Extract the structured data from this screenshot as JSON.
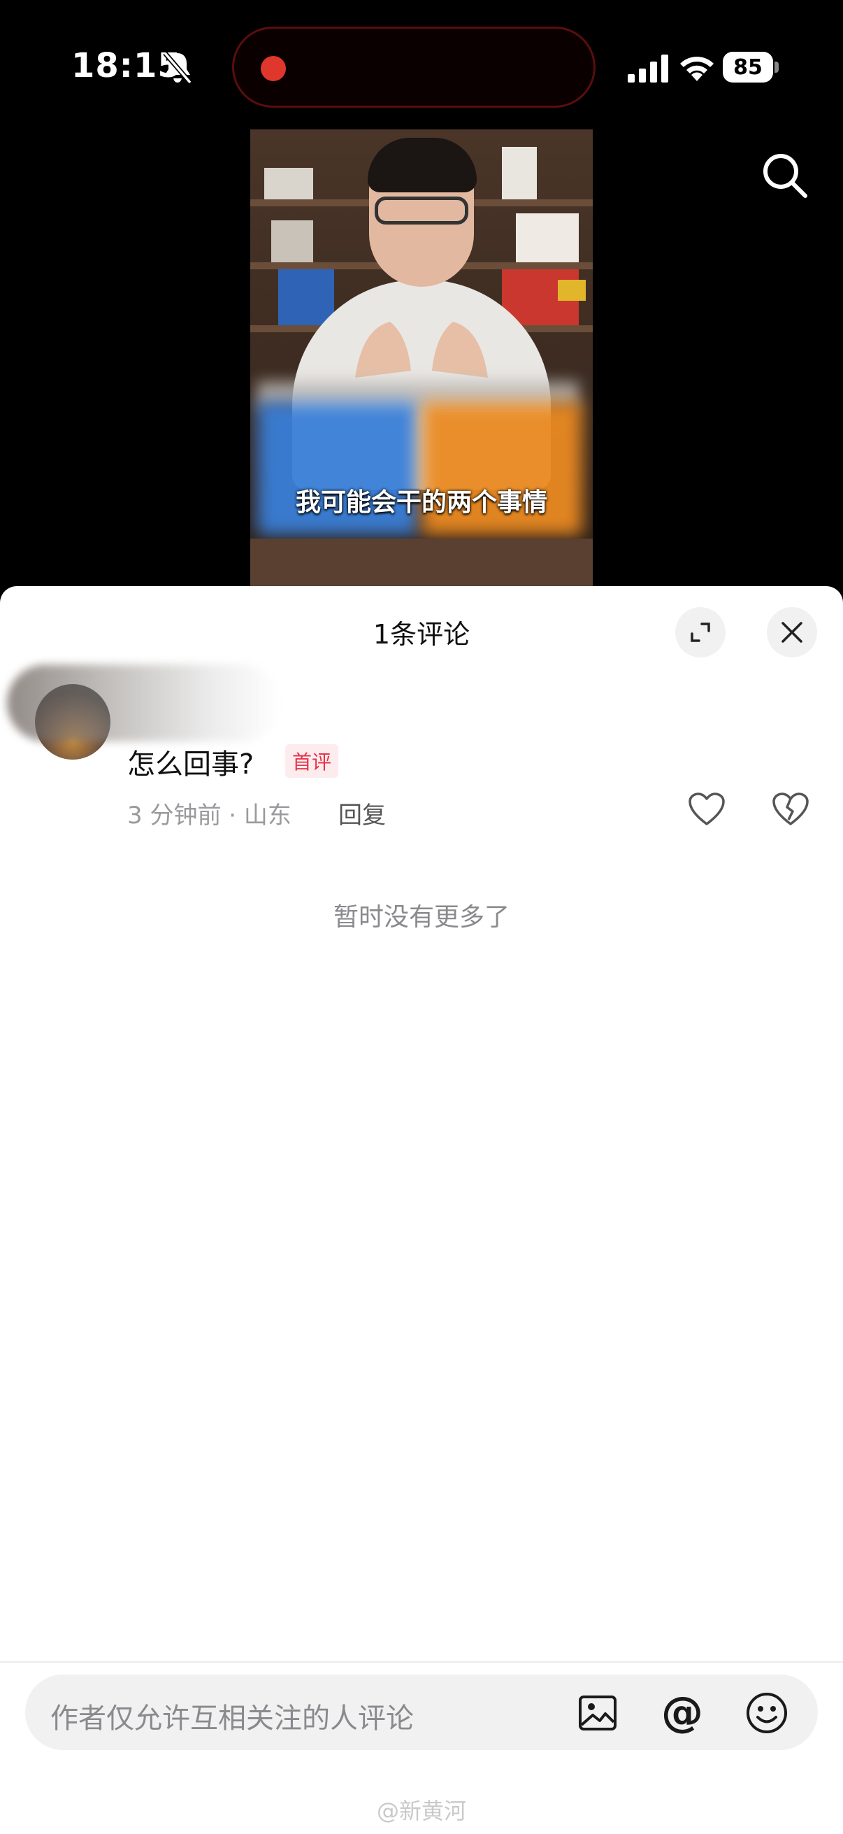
{
  "status_bar": {
    "time": "18:15",
    "battery": "85",
    "icons": [
      "bell-slash-icon",
      "recording-dot",
      "signal-icon",
      "wifi-icon",
      "battery-icon"
    ]
  },
  "video": {
    "subtitle": "我可能会干的两个事情"
  },
  "comments_sheet": {
    "title": "1条评论",
    "comments": [
      {
        "text": "怎么回事?",
        "badge": "首评",
        "meta": "3 分钟前 · 山东",
        "reply_label": "回复"
      }
    ],
    "no_more": "暂时没有更多了"
  },
  "input": {
    "placeholder": "作者仅允许互相关注的人评论",
    "at_symbol": "@"
  },
  "watermark": "@新黄河",
  "colors": {
    "badge_text": "#e8334a",
    "badge_bg": "#fdecee",
    "recording": "#e0372c"
  }
}
